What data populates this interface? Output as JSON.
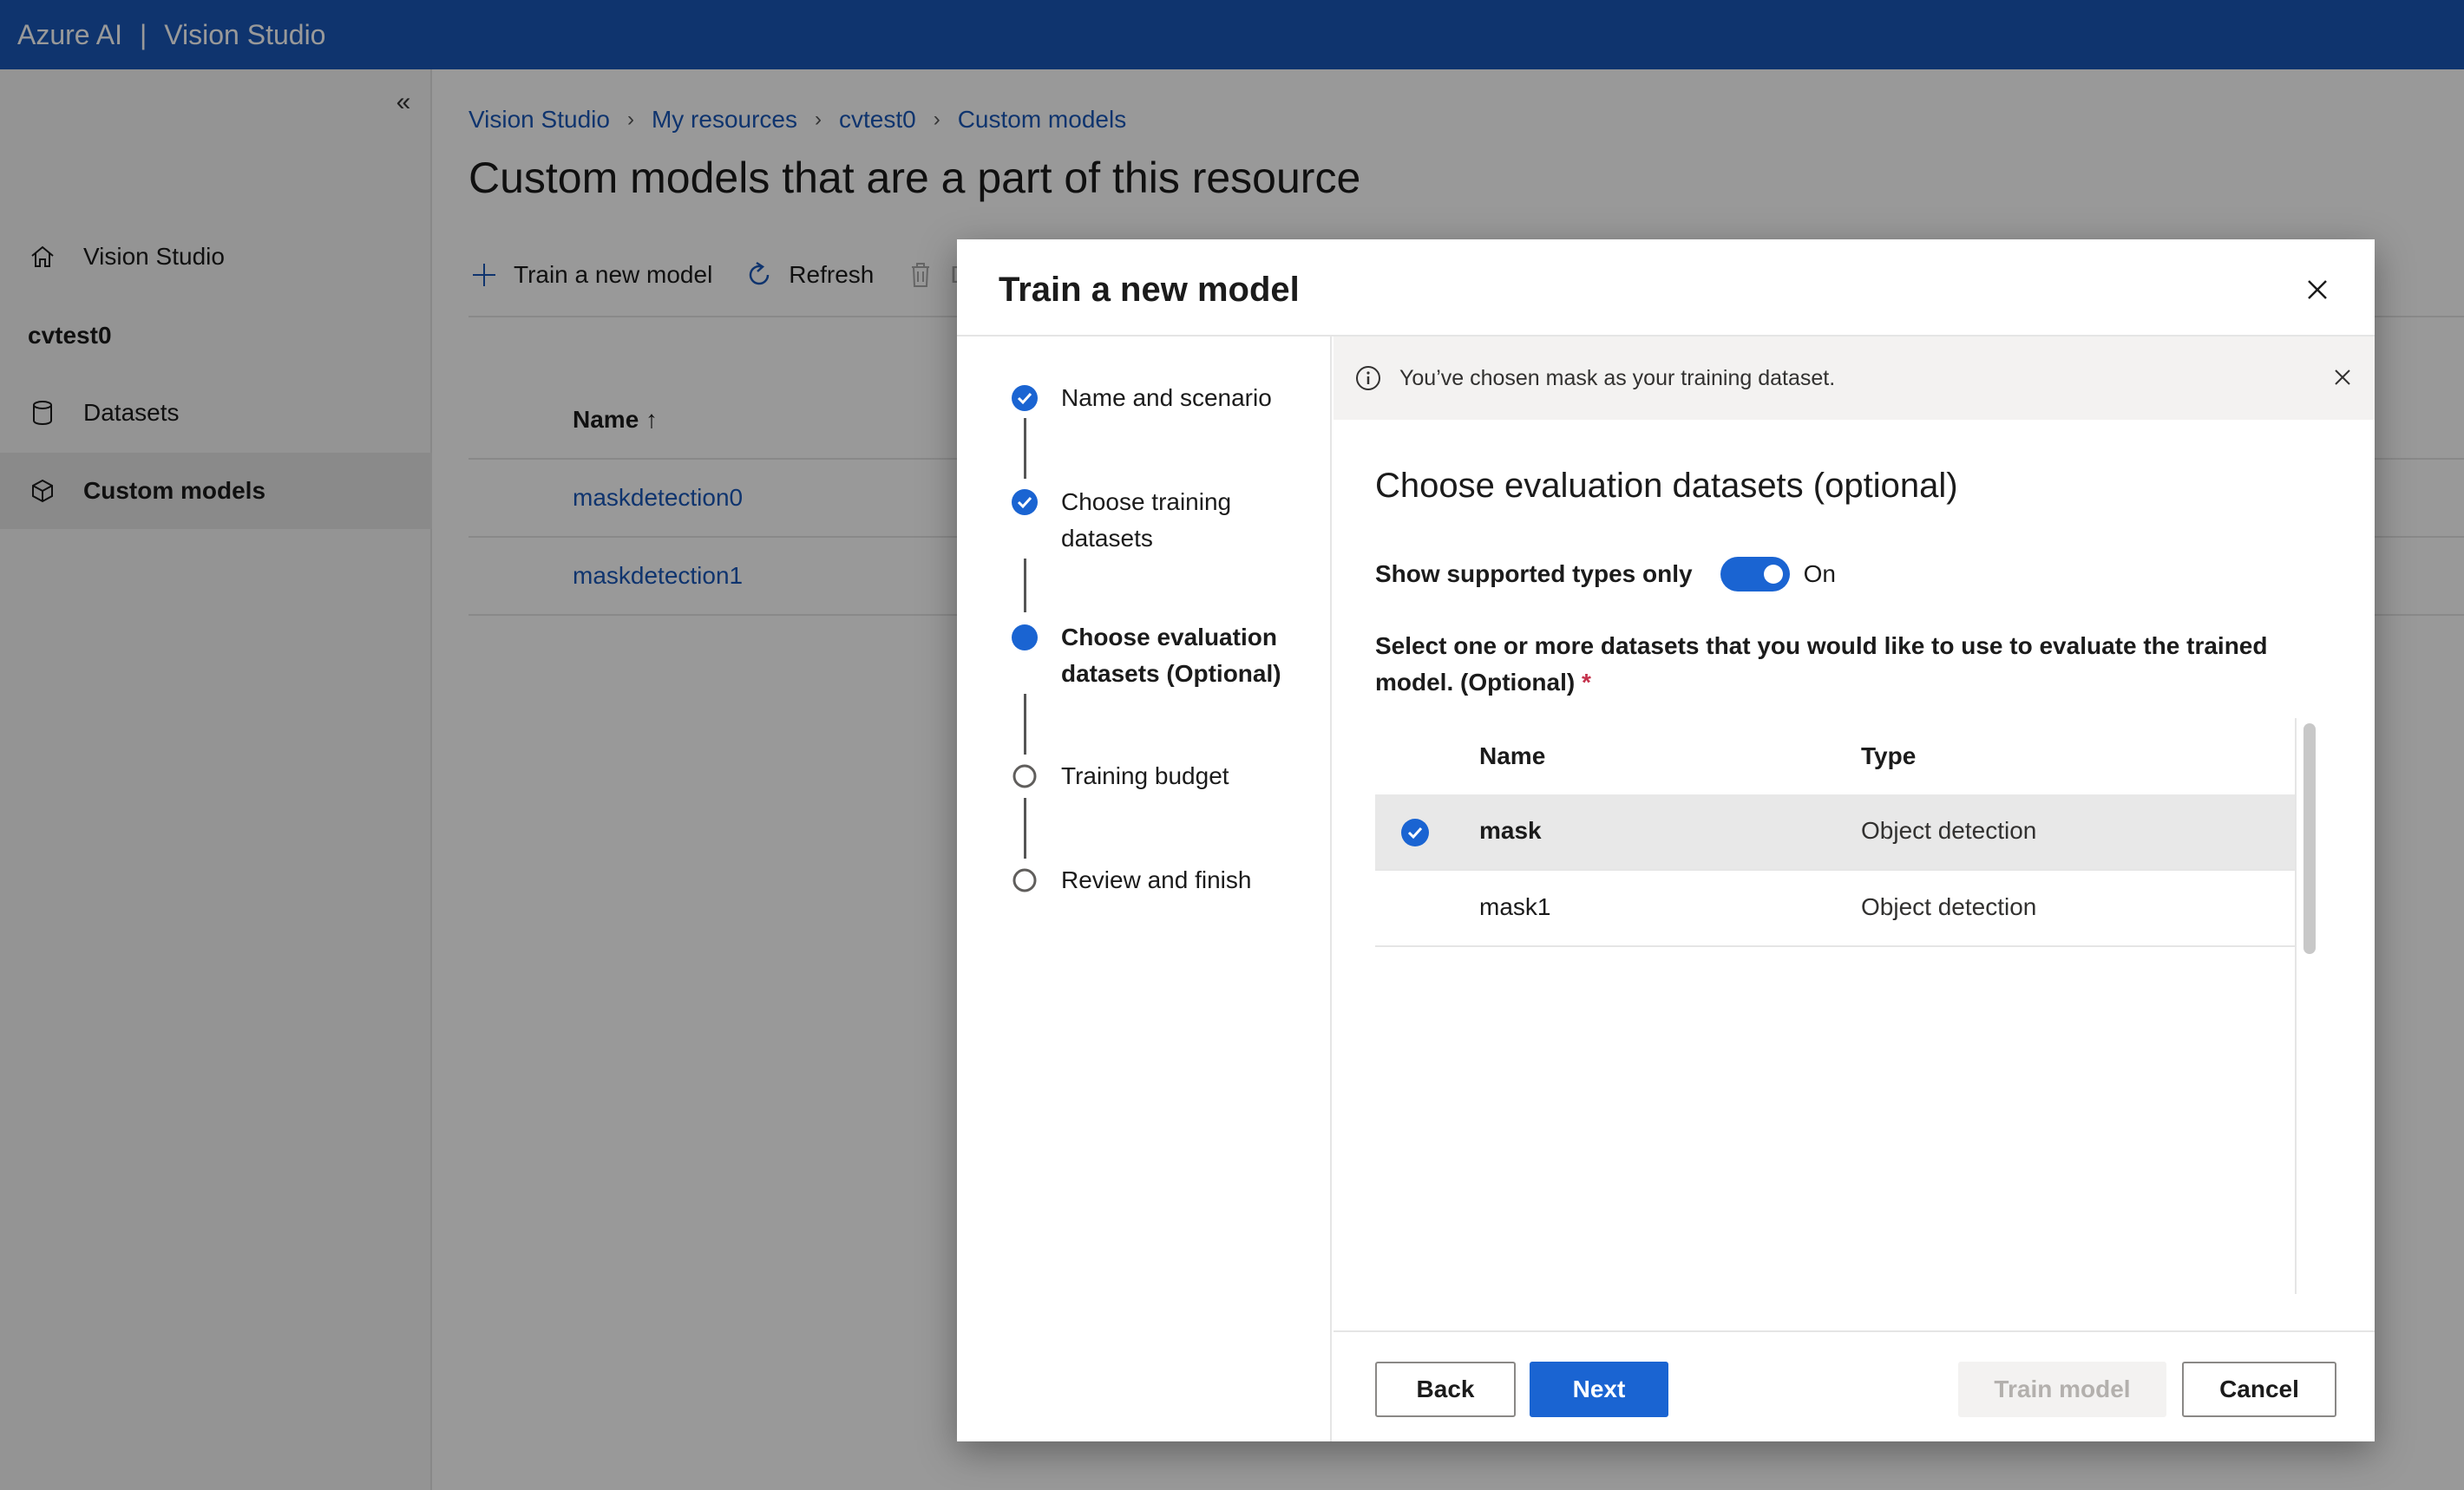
{
  "topbar": {
    "brand": "Azure AI",
    "separator": "|",
    "product": "Vision Studio"
  },
  "sidebar": {
    "collapse_glyph": "«",
    "home_label": "Vision Studio",
    "resource_name": "cvtest0",
    "datasets_label": "Datasets",
    "custom_models_label": "Custom models"
  },
  "breadcrumb": [
    "Vision Studio",
    "My resources",
    "cvtest0",
    "Custom models"
  ],
  "page_title": "Custom models that are a part of this resource",
  "commands": {
    "train": "Train a new model",
    "refresh": "Refresh",
    "delete_partial": "D"
  },
  "models_table": {
    "name_header": "Name",
    "sort_glyph": "↑",
    "rows": [
      "maskdetection0",
      "maskdetection1"
    ]
  },
  "dialog": {
    "title": "Train a new model",
    "steps": [
      {
        "label": "Name and scenario",
        "state": "done"
      },
      {
        "label": "Choose training datasets",
        "state": "done"
      },
      {
        "label": "Choose evaluation datasets (Optional)",
        "state": "active"
      },
      {
        "label": "Training budget",
        "state": "pending"
      },
      {
        "label": "Review and finish",
        "state": "pending"
      }
    ],
    "banner": "You’ve chosen mask as your training dataset.",
    "section_title": "Choose evaluation datasets (optional)",
    "toggle_label": "Show supported types only",
    "toggle_state": "On",
    "instruction": "Select one or more datasets that you would like to use to evaluate the trained model. (Optional)",
    "required_mark": "*",
    "table": {
      "col_name": "Name",
      "col_type": "Type",
      "rows": [
        {
          "name": "mask",
          "type": "Object detection",
          "selected": true
        },
        {
          "name": "mask1",
          "type": "Object detection",
          "selected": false
        }
      ]
    },
    "buttons": {
      "back": "Back",
      "next": "Next",
      "train": "Train model",
      "cancel": "Cancel"
    }
  },
  "colors": {
    "accent": "#1a64d2",
    "topbar": "#1a58b8",
    "link": "#1a58b8"
  }
}
